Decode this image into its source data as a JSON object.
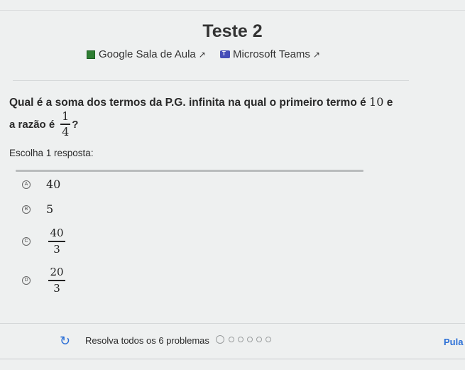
{
  "header": {
    "title": "Teste 2",
    "links": [
      {
        "label": "Google Sala de Aula",
        "icon": "google-classroom-icon"
      },
      {
        "label": "Microsoft Teams",
        "icon": "microsoft-teams-icon"
      }
    ]
  },
  "question": {
    "line1_text": "Qual é a soma dos termos da P.G. infinita na qual o primeiro termo é",
    "line1_number": "10",
    "line1_end": "e",
    "line2_text": "a razão é",
    "ratio_numerator": "1",
    "ratio_denominator": "4",
    "line2_end": "?"
  },
  "instruction": "Escolha 1 resposta:",
  "options": [
    {
      "letter": "A",
      "value": "40"
    },
    {
      "letter": "B",
      "value": "5"
    },
    {
      "letter": "C",
      "numerator": "40",
      "denominator": "3"
    },
    {
      "letter": "D",
      "numerator": "20",
      "denominator": "3"
    }
  ],
  "footer": {
    "progress_label": "Resolva todos os 6 problemas",
    "total_problems": 6,
    "current_problem": 1,
    "skip_label": "Pula"
  },
  "colors": {
    "accent": "#2b6fd6",
    "classroom_green": "#2e7d32",
    "teams_purple": "#464eb8"
  }
}
